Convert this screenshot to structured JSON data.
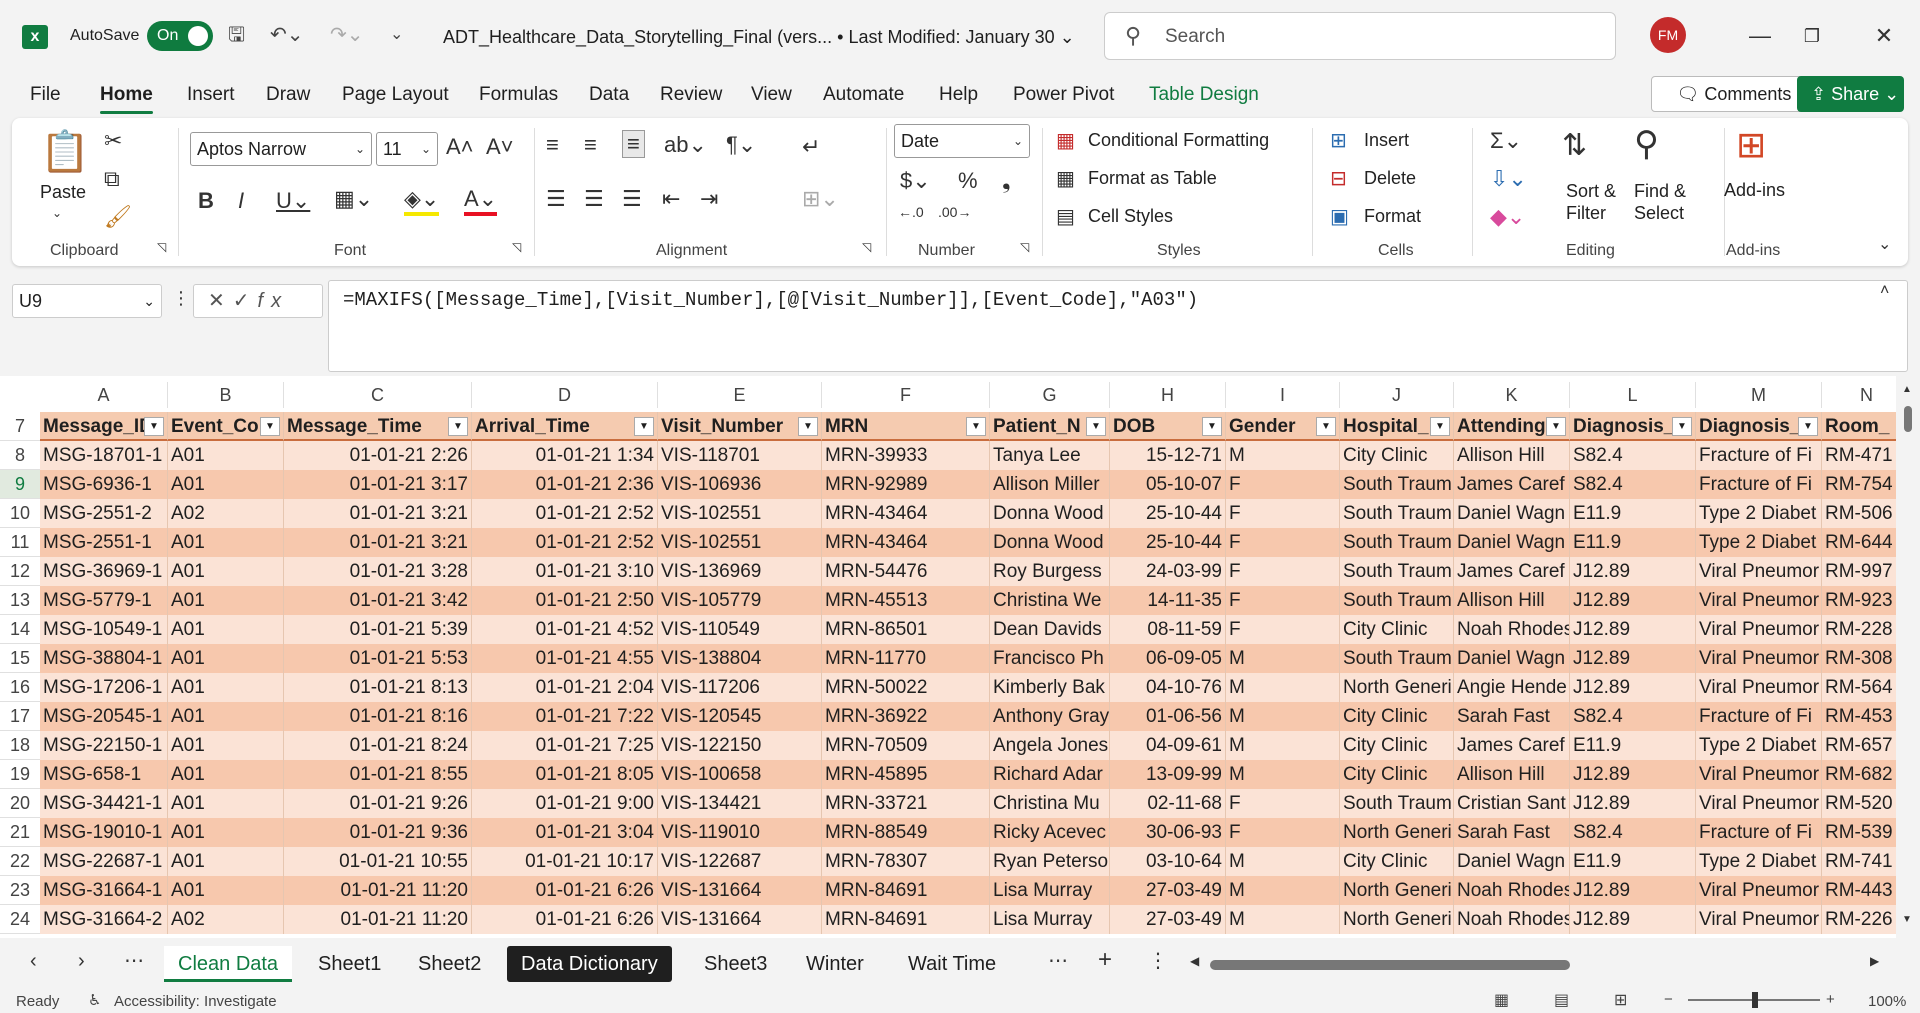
{
  "app": {
    "autosave_label": "AutoSave",
    "autosave_state": "On",
    "doc_title": "ADT_Healthcare_Data_Storytelling_Final (vers... • Last Modified: January 30 ⌄",
    "search_placeholder": "Search",
    "avatar_initials": "FM"
  },
  "menu": {
    "tabs": [
      "File",
      "Home",
      "Insert",
      "Draw",
      "Page Layout",
      "Formulas",
      "Data",
      "Review",
      "View",
      "Automate",
      "Help",
      "Power Pivot",
      "Table Design"
    ],
    "comments_label": "Comments",
    "share_label": "Share"
  },
  "ribbon": {
    "paste_label": "Paste",
    "clipboard_label": "Clipboard",
    "font_name": "Aptos Narrow",
    "font_size": "11",
    "font_label": "Font",
    "alignment_label": "Alignment",
    "number_format": "Date",
    "number_label": "Number",
    "cond_format": "Conditional Formatting",
    "format_table": "Format as Table",
    "cell_styles": "Cell Styles",
    "styles_label": "Styles",
    "insert_label": "Insert",
    "delete_label": "Delete",
    "format_label": "Format",
    "cells_label": "Cells",
    "sort_filter": "Sort & Filter",
    "find_select": "Find & Select",
    "editing_label": "Editing",
    "addins_btn": "Add-ins",
    "addins_label": "Add-ins"
  },
  "formula_bar": {
    "name_box": "U9",
    "formula": "=MAXIFS([Message_Time],[Visit_Number],[@[Visit_Number]],[Event_Code],\"A03\")"
  },
  "sheet": {
    "columns": [
      "A",
      "B",
      "C",
      "D",
      "E",
      "F",
      "G",
      "H",
      "I",
      "J",
      "K",
      "L",
      "M",
      "N"
    ],
    "headers": [
      "Message_ID",
      "Event_Co",
      "Message_Time",
      "Arrival_Time",
      "Visit_Number",
      "MRN",
      "Patient_N",
      "DOB",
      "Gender",
      "Hospital_",
      "Attending",
      "Diagnosis_",
      "Diagnosis_",
      "Room_"
    ],
    "header_row_number": "7",
    "selected_row": "9",
    "rows": [
      {
        "n": "8",
        "cells": [
          "MSG-18701-1",
          "A01",
          "01-01-21 2:26",
          "01-01-21 1:34",
          "VIS-118701",
          "MRN-39933",
          "Tanya Lee",
          "15-12-71",
          "M",
          "City Clinic",
          "Allison Hill",
          "S82.4",
          "Fracture of Fi",
          "RM-471"
        ]
      },
      {
        "n": "9",
        "cells": [
          "MSG-6936-1",
          "A01",
          "01-01-21 3:17",
          "01-01-21 2:36",
          "VIS-106936",
          "MRN-92989",
          "Allison Miller",
          "05-10-07",
          "F",
          "South Traum",
          "James Caref",
          "S82.4",
          "Fracture of Fi",
          "RM-754"
        ]
      },
      {
        "n": "10",
        "cells": [
          "MSG-2551-2",
          "A02",
          "01-01-21 3:21",
          "01-01-21 2:52",
          "VIS-102551",
          "MRN-43464",
          "Donna Wood",
          "25-10-44",
          "F",
          "South Traum",
          "Daniel Wagn",
          "E11.9",
          "Type 2 Diabet",
          "RM-506"
        ]
      },
      {
        "n": "11",
        "cells": [
          "MSG-2551-1",
          "A01",
          "01-01-21 3:21",
          "01-01-21 2:52",
          "VIS-102551",
          "MRN-43464",
          "Donna Wood",
          "25-10-44",
          "F",
          "South Traum",
          "Daniel Wagn",
          "E11.9",
          "Type 2 Diabet",
          "RM-644"
        ]
      },
      {
        "n": "12",
        "cells": [
          "MSG-36969-1",
          "A01",
          "01-01-21 3:28",
          "01-01-21 3:10",
          "VIS-136969",
          "MRN-54476",
          "Roy Burgess",
          "24-03-99",
          "F",
          "South Traum",
          "James Caref",
          "J12.89",
          "Viral Pneumor",
          "RM-997"
        ]
      },
      {
        "n": "13",
        "cells": [
          "MSG-5779-1",
          "A01",
          "01-01-21 3:42",
          "01-01-21 2:50",
          "VIS-105779",
          "MRN-45513",
          "Christina We",
          "14-11-35",
          "F",
          "South Traum",
          "Allison Hill",
          "J12.89",
          "Viral Pneumor",
          "RM-923"
        ]
      },
      {
        "n": "14",
        "cells": [
          "MSG-10549-1",
          "A01",
          "01-01-21 5:39",
          "01-01-21 4:52",
          "VIS-110549",
          "MRN-86501",
          "Dean Davids",
          "08-11-59",
          "F",
          "City Clinic",
          "Noah Rhodes",
          "J12.89",
          "Viral Pneumor",
          "RM-228"
        ]
      },
      {
        "n": "15",
        "cells": [
          "MSG-38804-1",
          "A01",
          "01-01-21 5:53",
          "01-01-21 4:55",
          "VIS-138804",
          "MRN-11770",
          "Francisco Ph",
          "06-09-05",
          "M",
          "South Traum",
          "Daniel Wagn",
          "J12.89",
          "Viral Pneumor",
          "RM-308"
        ]
      },
      {
        "n": "16",
        "cells": [
          "MSG-17206-1",
          "A01",
          "01-01-21 8:13",
          "01-01-21 2:04",
          "VIS-117206",
          "MRN-50022",
          "Kimberly Bak",
          "04-10-76",
          "M",
          "North Generi",
          "Angie Hende",
          "J12.89",
          "Viral Pneumor",
          "RM-564"
        ]
      },
      {
        "n": "17",
        "cells": [
          "MSG-20545-1",
          "A01",
          "01-01-21 8:16",
          "01-01-21 7:22",
          "VIS-120545",
          "MRN-36922",
          "Anthony Gray",
          "01-06-56",
          "M",
          "City Clinic",
          "Sarah Fast",
          "S82.4",
          "Fracture of Fi",
          "RM-453"
        ]
      },
      {
        "n": "18",
        "cells": [
          "MSG-22150-1",
          "A01",
          "01-01-21 8:24",
          "01-01-21 7:25",
          "VIS-122150",
          "MRN-70509",
          "Angela Jones",
          "04-09-61",
          "M",
          "City Clinic",
          "James Caref",
          "E11.9",
          "Type 2 Diabet",
          "RM-657"
        ]
      },
      {
        "n": "19",
        "cells": [
          "MSG-658-1",
          "A01",
          "01-01-21 8:55",
          "01-01-21 8:05",
          "VIS-100658",
          "MRN-45895",
          "Richard Adar",
          "13-09-99",
          "M",
          "City Clinic",
          "Allison Hill",
          "J12.89",
          "Viral Pneumor",
          "RM-682"
        ]
      },
      {
        "n": "20",
        "cells": [
          "MSG-34421-1",
          "A01",
          "01-01-21 9:26",
          "01-01-21 9:00",
          "VIS-134421",
          "MRN-33721",
          "Christina Mu",
          "02-11-68",
          "F",
          "South Traum",
          "Cristian Sant",
          "J12.89",
          "Viral Pneumor",
          "RM-520"
        ]
      },
      {
        "n": "21",
        "cells": [
          "MSG-19010-1",
          "A01",
          "01-01-21 9:36",
          "01-01-21 3:04",
          "VIS-119010",
          "MRN-88549",
          "Ricky Acevec",
          "30-06-93",
          "F",
          "North Generi",
          "Sarah Fast",
          "S82.4",
          "Fracture of Fi",
          "RM-539"
        ]
      },
      {
        "n": "22",
        "cells": [
          "MSG-22687-1",
          "A01",
          "01-01-21 10:55",
          "01-01-21 10:17",
          "VIS-122687",
          "MRN-78307",
          "Ryan Peterso",
          "03-10-64",
          "M",
          "City Clinic",
          "Daniel Wagn",
          "E11.9",
          "Type 2 Diabet",
          "RM-741"
        ]
      },
      {
        "n": "23",
        "cells": [
          "MSG-31664-1",
          "A01",
          "01-01-21 11:20",
          "01-01-21 6:26",
          "VIS-131664",
          "MRN-84691",
          "Lisa Murray",
          "27-03-49",
          "M",
          "North Generi",
          "Noah Rhodes",
          "J12.89",
          "Viral Pneumor",
          "RM-443"
        ]
      },
      {
        "n": "24",
        "cells": [
          "MSG-31664-2",
          "A02",
          "01-01-21 11:20",
          "01-01-21 6:26",
          "VIS-131664",
          "MRN-84691",
          "Lisa Murray",
          "27-03-49",
          "M",
          "North Generi",
          "Noah Rhodes",
          "J12.89",
          "Viral Pneumor",
          "RM-226"
        ]
      }
    ]
  },
  "sheet_tabs": [
    "Clean Data",
    "Sheet1",
    "Sheet2",
    "Data Dictionary",
    "Sheet3",
    "Winter",
    "Wait Time"
  ],
  "status": {
    "ready": "Ready",
    "accessibility": "Accessibility: Investigate",
    "zoom": "100%"
  },
  "colors": {
    "accent": "#107c41",
    "header_fill": "#f5cbb0",
    "band_a": "#fbe3d6",
    "band_b": "#f7c8ad"
  }
}
